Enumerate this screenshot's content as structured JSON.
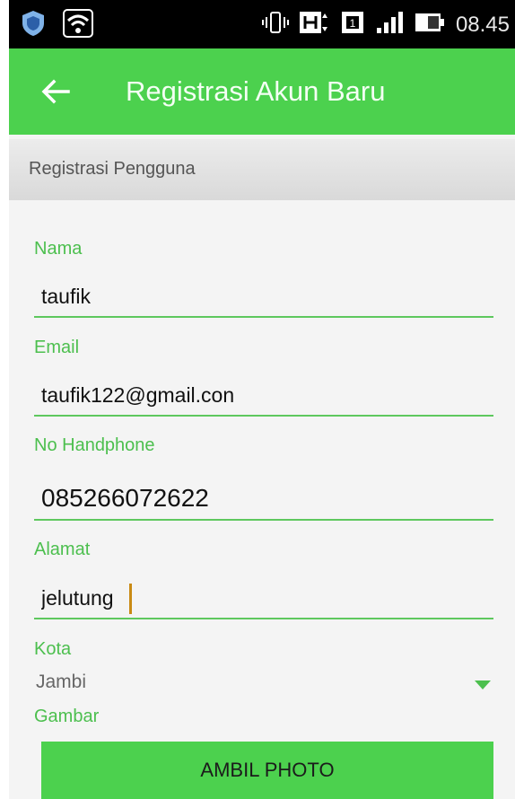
{
  "status_bar": {
    "time": "08.45",
    "icons": [
      "shield-icon",
      "wifi-icon",
      "vibrate-icon",
      "h-network-icon",
      "sim-1-icon",
      "signal-icon",
      "battery-icon"
    ]
  },
  "app_bar": {
    "title": "Registrasi Akun Baru",
    "back_icon": "arrow-left-icon"
  },
  "section": {
    "title": "Registrasi Pengguna"
  },
  "form": {
    "nama": {
      "label": "Nama",
      "value": "taufik"
    },
    "email": {
      "label": "Email",
      "value": "taufik122@gmail.con"
    },
    "hp": {
      "label": "No Handphone",
      "value": "085266072622"
    },
    "alamat": {
      "label": "Alamat",
      "value": "jelutung"
    },
    "kota": {
      "label": "Kota",
      "value": "Jambi"
    },
    "gambar": {
      "label": "Gambar"
    }
  },
  "buttons": {
    "ambil_photo": "AMBIL PHOTO"
  },
  "colors": {
    "accent": "#4cd14e",
    "label": "#4cbf4e",
    "cursor": "#c98a14"
  }
}
